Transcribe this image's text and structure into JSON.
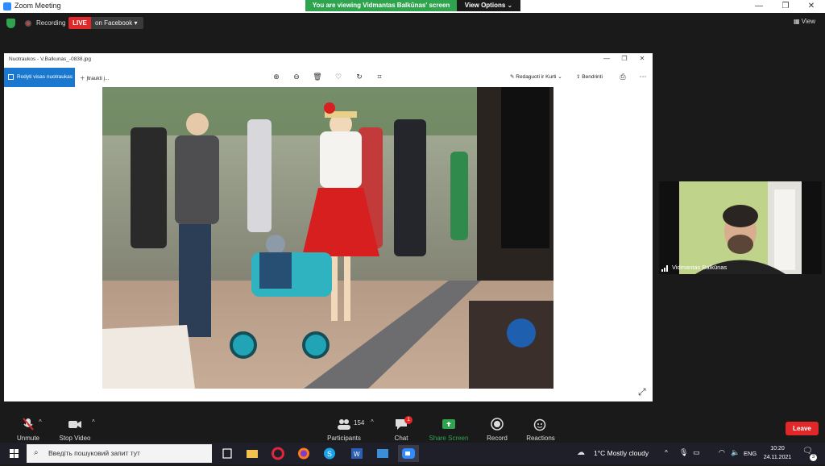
{
  "zoom": {
    "window_title": "Zoom Meeting",
    "banner": {
      "message": "You are viewing Vidmantas Balkūnas' screen",
      "options_label": "View Options"
    },
    "recording_label": "Recording",
    "live_label": "LIVE",
    "live_destination": "on Facebook",
    "view_label": "View",
    "window_controls": [
      "—",
      "❐",
      "✕"
    ]
  },
  "photos_app": {
    "title": "Nuotraukos - V.Balkunas_-0838.jpg",
    "see_all_label": "Rodyti visas nuotraukas",
    "add_to_label": "Įtraukti į...",
    "edit_label": "Redaguoti ir Kurti",
    "share_label": "Bendrinti",
    "toolbar_icons": [
      "zoom-in-icon",
      "zoom-out-icon",
      "delete-icon",
      "favorite-icon",
      "rotate-icon",
      "crop-icon"
    ],
    "window_controls": [
      "—",
      "❐",
      "✕"
    ]
  },
  "participant": {
    "name": "Vidmantas Balkūnas"
  },
  "toolbar": {
    "unmute": "Unmute",
    "stop_video": "Stop Video",
    "participants_label": "Participants",
    "participants_count": "154",
    "chat_label": "Chat",
    "chat_badge": "1",
    "share_label": "Share Screen",
    "record_label": "Record",
    "reactions_label": "Reactions",
    "leave_label": "Leave"
  },
  "taskbar": {
    "search_placeholder": "Введіть пошуковий запит тут",
    "weather": "1°C  Mostly cloudy",
    "lang": "ENG",
    "time": "10:20",
    "date": "24.11.2021",
    "notification_count": "3"
  },
  "colors": {
    "zoom_green": "#2ea44f",
    "live_red": "#e02828",
    "photos_blue": "#1b78d0",
    "taskbar": "#1f1f2a"
  }
}
